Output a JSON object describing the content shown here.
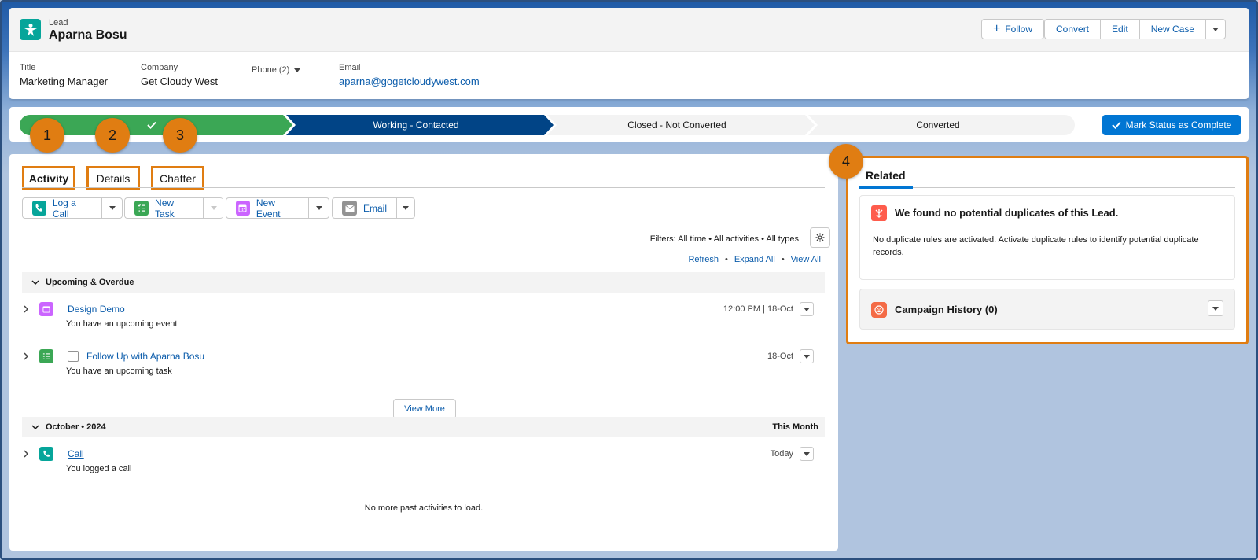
{
  "record": {
    "object_label": "Lead",
    "name": "Aparna Bosu",
    "buttons": {
      "follow": "Follow",
      "convert": "Convert",
      "edit": "Edit",
      "new_case": "New Case"
    }
  },
  "fields": {
    "title_label": "Title",
    "title_value": "Marketing Manager",
    "company_label": "Company",
    "company_value": "Get Cloudy West",
    "phone_label": "Phone (2)",
    "email_label": "Email",
    "email_value": "aparna@gogetcloudywest.com"
  },
  "path": {
    "steps": [
      "Working - Contacted",
      "Closed - Not Converted",
      "Converted"
    ],
    "mark_button": "Mark Status as Complete"
  },
  "tabs": {
    "activity": "Activity",
    "details": "Details",
    "chatter": "Chatter"
  },
  "callouts": [
    "1",
    "2",
    "3",
    "4"
  ],
  "actions": {
    "log_call": "Log a Call",
    "new_task": "New Task",
    "new_event": "New Event",
    "email": "Email"
  },
  "filters": {
    "text": "Filters: All time • All activities • All types",
    "refresh": "Refresh",
    "expand_all": "Expand All",
    "view_all": "View All",
    "sep": "•"
  },
  "upcoming": {
    "header": "Upcoming & Overdue",
    "items": [
      {
        "title": "Design Demo",
        "subtitle": "You have an upcoming event",
        "date": "12:00 PM | 18-Oct"
      },
      {
        "title": "Follow Up with Aparna Bosu",
        "subtitle": "You have an upcoming task",
        "date": "18-Oct"
      }
    ],
    "view_more": "View More"
  },
  "past": {
    "header": "October • 2024",
    "header_right": "This Month",
    "items": [
      {
        "title": "Call",
        "subtitle": "You logged a call",
        "date": "Today"
      }
    ],
    "no_more": "No more past activities to load."
  },
  "related": {
    "tab": "Related",
    "dup_title": "We found no potential duplicates of this Lead.",
    "dup_text": "No duplicate rules are activated. Activate duplicate rules to identify potential duplicate records.",
    "campaign_title": "Campaign History (0)"
  },
  "colors": {
    "accent": "#0176d3",
    "path_done": "#3ba755",
    "path_current": "#014486",
    "highlight": "#e07d12"
  }
}
